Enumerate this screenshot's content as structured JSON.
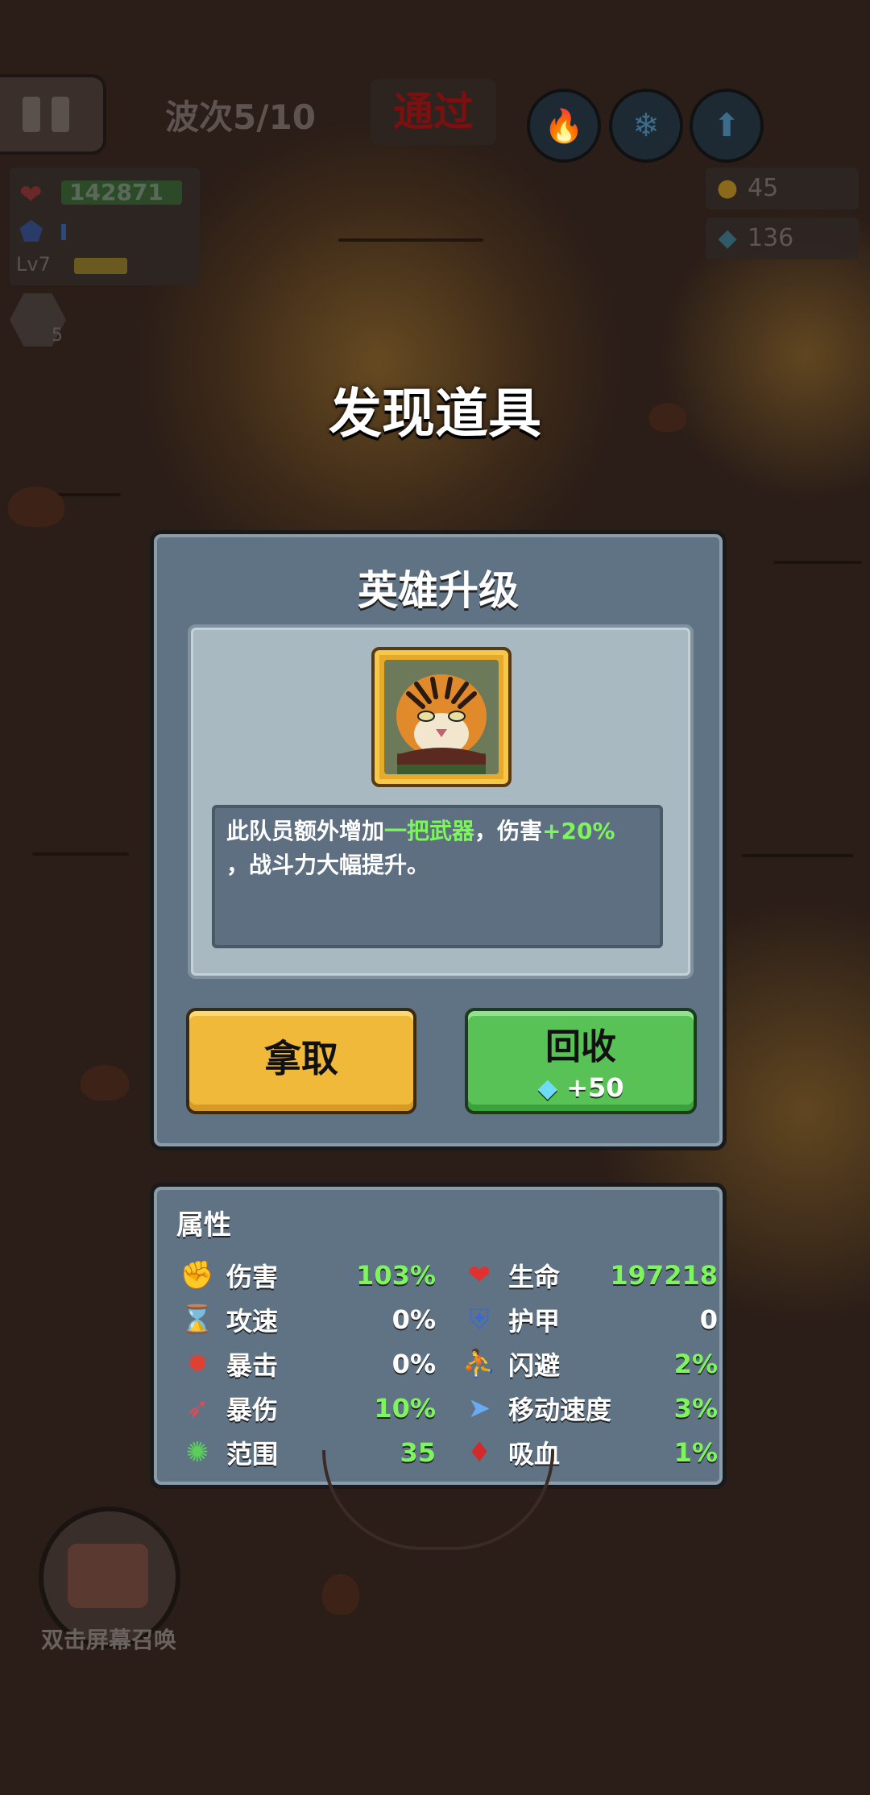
{
  "hud": {
    "wave_label": "波次5/10",
    "pass_label": "通过",
    "skills": [
      "flame-icon",
      "crystal-icon",
      "hammer-icon"
    ],
    "hp_value": "142871",
    "level": "Lv7",
    "rocket_count": "5",
    "coins": "45",
    "gems": "136"
  },
  "modal": {
    "title": "发现道具",
    "card_title": "英雄升级",
    "portrait": "tiger-hero-portrait",
    "desc_prefix": "此队员额外增加",
    "desc_hl1": "一把武器",
    "desc_mid": "，伤害",
    "desc_hl2": "+20%",
    "desc_suffix": "，战斗力大幅提升。",
    "take_label": "拿取",
    "recycle_label": "回收",
    "recycle_reward": "+50"
  },
  "attributes": {
    "title": "属性",
    "left": [
      {
        "name": "伤害",
        "value": "103%",
        "icon": "fist-icon",
        "color": "#7ef55e"
      },
      {
        "name": "攻速",
        "value": "0%",
        "icon": "hourglass-icon",
        "color": "#ffffff"
      },
      {
        "name": "暴击",
        "value": "0%",
        "icon": "burst-icon",
        "color": "#ffffff"
      },
      {
        "name": "暴伤",
        "value": "10%",
        "icon": "arrow-icon",
        "color": "#7ef55e"
      },
      {
        "name": "范围",
        "value": "35",
        "icon": "gear-icon",
        "color": "#7ef55e"
      }
    ],
    "right": [
      {
        "name": "生命",
        "value": "197218",
        "icon": "heart-icon",
        "color": "#7ef55e"
      },
      {
        "name": "护甲",
        "value": "0",
        "icon": "shield-icon",
        "color": "#ffffff"
      },
      {
        "name": "闪避",
        "value": "2%",
        "icon": "dodge-icon",
        "color": "#7ef55e"
      },
      {
        "name": "移动速度",
        "value": "3%",
        "icon": "speed-icon",
        "color": "#7ef55e"
      },
      {
        "name": "吸血",
        "value": "1%",
        "icon": "blood-drop-icon",
        "color": "#7ef55e"
      }
    ]
  },
  "summon_label": "双击屏幕召唤"
}
